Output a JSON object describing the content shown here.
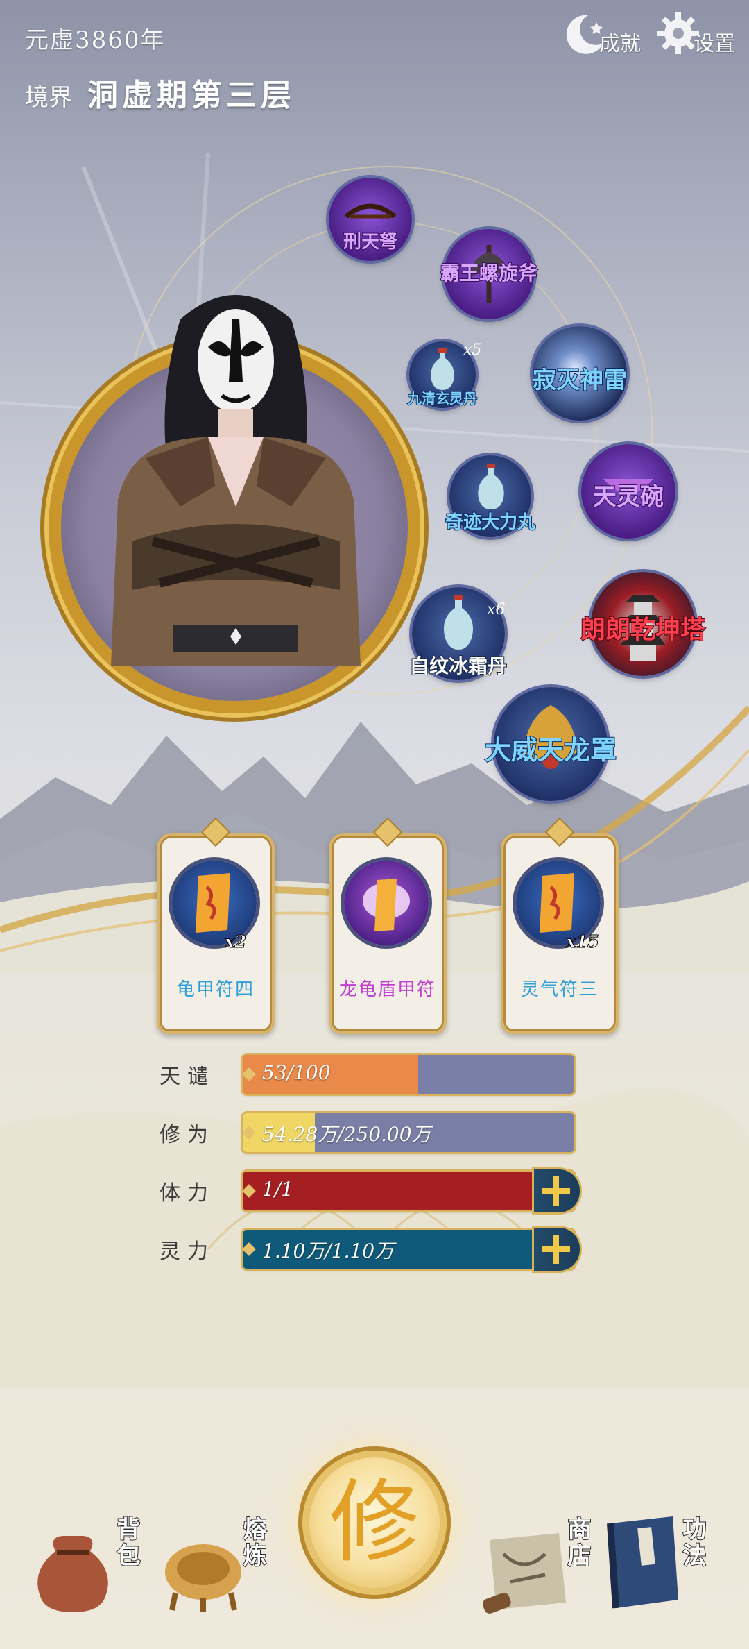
{
  "header": {
    "year": "元虚3860年",
    "realm_label": "境界",
    "realm_value": "洞虚期第三层"
  },
  "top_buttons": {
    "achievements": "成就",
    "settings": "设置"
  },
  "equipment": [
    {
      "name": "刑天弩",
      "color": "purple"
    },
    {
      "name": "霸王螺旋斧",
      "color": "purple"
    },
    {
      "name": "九清玄灵丹",
      "count": "x5",
      "color": "blue"
    },
    {
      "name": "寂灭神雷",
      "color": "blue"
    },
    {
      "name": "奇迹大力丸",
      "color": "blue"
    },
    {
      "name": "天灵碗",
      "color": "purple"
    },
    {
      "name": "白纹冰霜丹",
      "count": "x6",
      "color": "white"
    },
    {
      "name": "朗朗乾坤塔",
      "color": "red"
    },
    {
      "name": "大威天龙罩",
      "color": "blue"
    }
  ],
  "talismans": [
    {
      "name": "龟甲符四",
      "count": "x2",
      "color": "#2f9fd8"
    },
    {
      "name": "龙龟盾甲符",
      "count": "",
      "color": "#c03fd0"
    },
    {
      "name": "灵气符三",
      "count": "x15",
      "color": "#2f9fd8"
    }
  ],
  "stats": [
    {
      "label": "天谴",
      "value": "53/100",
      "fraction": 0.53,
      "fill_color": "#e9894a",
      "track_color": "#7a7fa8"
    },
    {
      "label": "修为",
      "value": "54.28万/250.00万",
      "fraction": 0.217,
      "fill_color": "#f0d765",
      "track_color": "#7a7fa8"
    },
    {
      "label": "体力",
      "value": "1/1",
      "fraction": 1.0,
      "fill_color": "#a51e22",
      "track_color": "#a51e22"
    },
    {
      "label": "灵力",
      "value": "1.10万/1.10万",
      "fraction": 1.0,
      "fill_color": "#0f5a7a",
      "track_color": "#0f5a7a"
    }
  ],
  "cultivate": {
    "label": "修"
  },
  "nav": {
    "bag": "背包",
    "smelt": "熔炼",
    "shop": "商店",
    "skills": "功法"
  }
}
